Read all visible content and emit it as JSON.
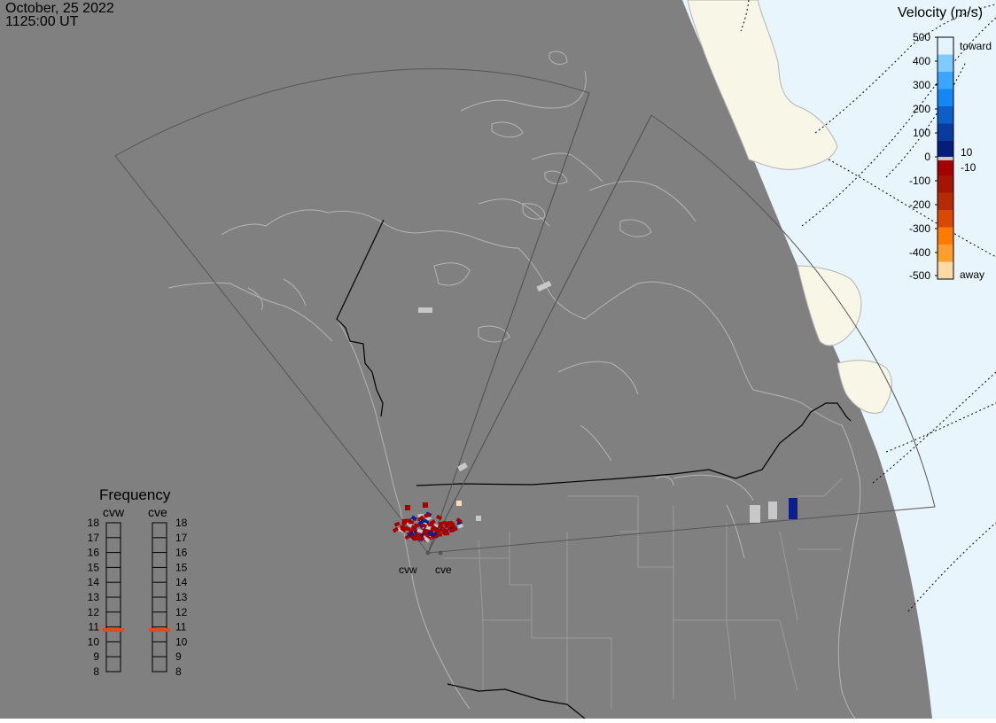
{
  "header": {
    "date": "October, 25 2022",
    "time": "1125:00 UT"
  },
  "colors": {
    "night": "#808080",
    "day_ocean": "#e8f5fd",
    "day_land": "#f8f6e6",
    "coast": "#b4b4b4",
    "border": "#000000",
    "fov": "#555555",
    "latlon": "#000000"
  },
  "legend": {
    "title": "Velocity (m/s)",
    "ticks": [
      "500",
      "400",
      "300",
      "200",
      "100",
      "0",
      "-100",
      "-200",
      "-300",
      "-400",
      "-500"
    ],
    "toward_label": "toward",
    "away_label": "away",
    "thresh_pos": "10",
    "thresh_neg": "-10",
    "colors": [
      "#e3f4ff",
      "#7fcaff",
      "#3aa6ff",
      "#1587f2",
      "#0d5fc8",
      "#0a3ca0",
      "#061e7a",
      "#a50000",
      "#a31605",
      "#b52b05",
      "#d94a00",
      "#ff7a00",
      "#ff9e2c",
      "#ffd8a8"
    ]
  },
  "frequency": {
    "title": "Frequency",
    "radars": [
      "cvw",
      "cve"
    ],
    "levels": [
      "18",
      "17",
      "16",
      "15",
      "14",
      "13",
      "12",
      "11",
      "10",
      "9",
      "8"
    ],
    "current_mhz": [
      10.8,
      10.8
    ],
    "marker_color": "#e04a1e"
  },
  "sites": [
    {
      "code": "cvw"
    },
    {
      "code": "cve"
    }
  ]
}
